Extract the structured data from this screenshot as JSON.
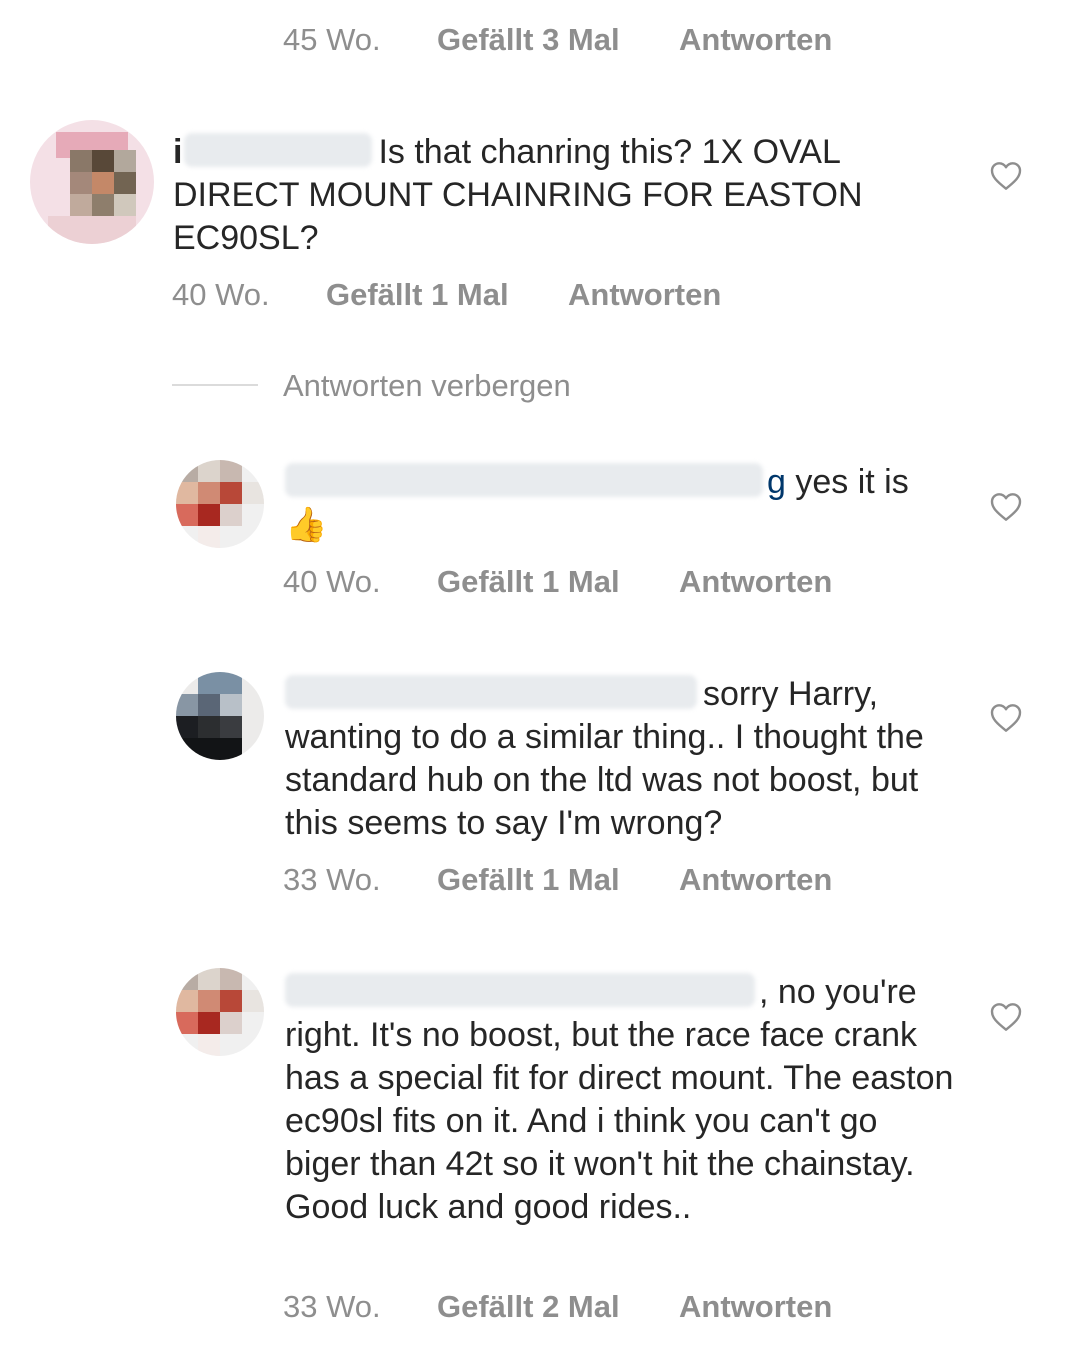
{
  "comments": [
    {
      "time": "45 Wo.",
      "likes": "Gefällt 3 Mal",
      "reply": "Antworten"
    },
    {
      "text": "Is that chanring this? 1X OVAL DIRECT MOUNT CHAINRING FOR EASTON EC90SL?",
      "time": "40 Wo.",
      "likes": "Gefällt 1 Mal",
      "reply": "Antworten",
      "username_partial": "i"
    },
    {
      "text_partial": "g",
      "text": "yes it is",
      "emoji": "👍",
      "time": "40 Wo.",
      "likes": "Gefällt 1 Mal",
      "reply": "Antworten"
    },
    {
      "text_first": "sorry Harry,",
      "text": "wanting to do a similar thing.. I thought the standard hub on the ltd was not boost, but this seems to say I'm wrong?",
      "time": "33 Wo.",
      "likes": "Gefällt 1 Mal",
      "reply": "Antworten"
    },
    {
      "text_first": ", no you're",
      "text": "right. It's no boost, but the race face crank has a special fit for direct mount. The easton ec90sl fits on it. And i think you can't go biger than 42t so it won't hit the chainstay. Good luck and good rides..",
      "time": "33 Wo.",
      "likes": "Gefällt 2 Mal",
      "reply": "Antworten"
    }
  ],
  "hide_replies": "Antworten verbergen",
  "icons": {
    "like": "heart-outline-icon"
  },
  "colors": {
    "text": "#262626",
    "meta": "#8e8e8e",
    "link": "#00376b",
    "divider": "#dbdbdb"
  }
}
